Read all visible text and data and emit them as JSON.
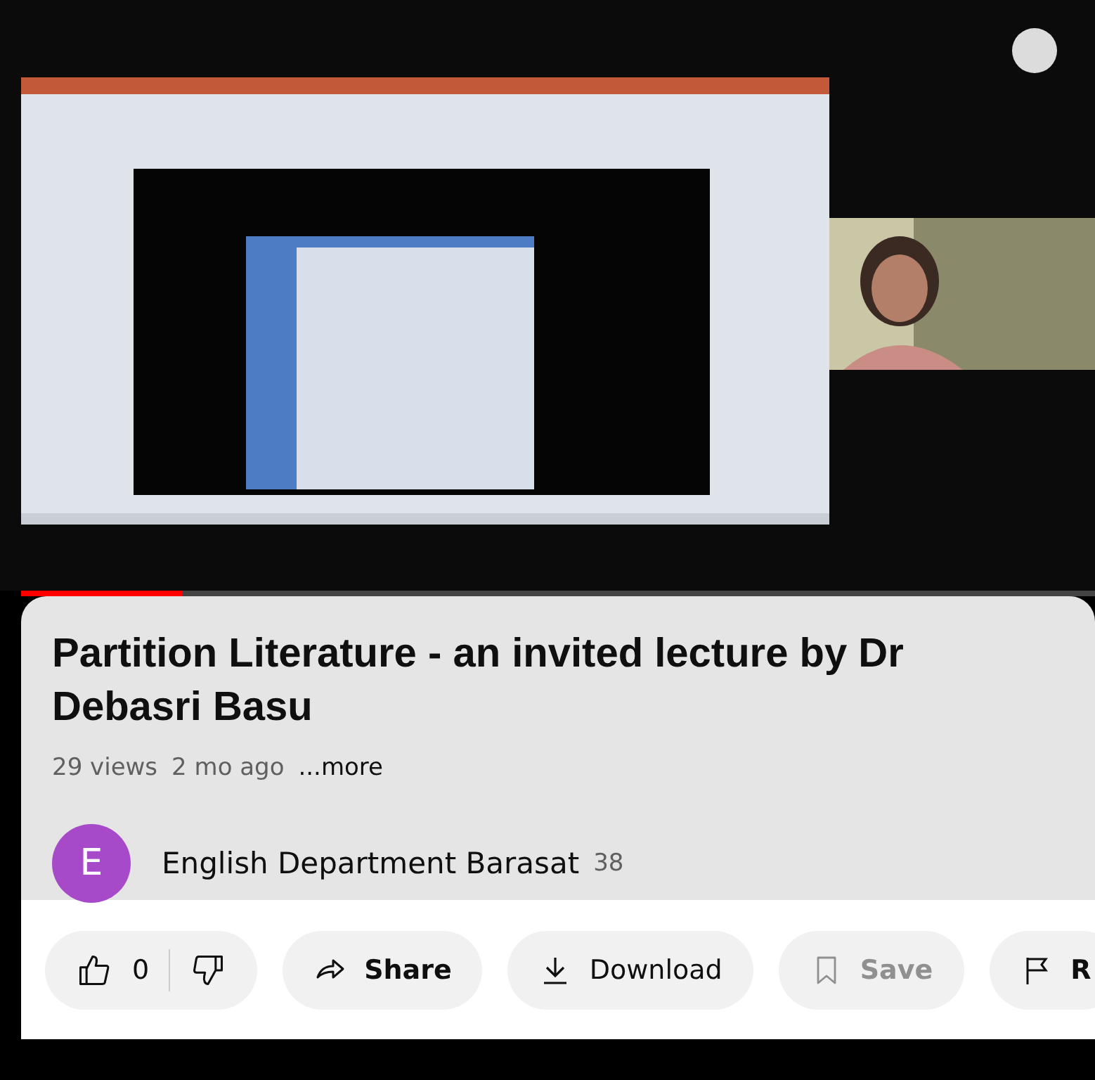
{
  "progress": {
    "level": 0.15
  },
  "title": "Partition Literature - an invited lecture by Dr Debasri Basu",
  "meta": {
    "views": "29 views",
    "age": "2 mo ago",
    "more": "...more"
  },
  "channel": {
    "avatar_letter": "E",
    "name": "English Department Barasat",
    "subscribers": "38"
  },
  "likes": {
    "count": "0"
  },
  "actions": [
    {
      "kind": "share",
      "label": "Share",
      "disabled": false
    },
    {
      "kind": "download",
      "label": "Download",
      "disabled": false
    },
    {
      "kind": "save",
      "label": "Save",
      "disabled": true
    },
    {
      "kind": "report",
      "label": "R",
      "disabled": false
    }
  ]
}
